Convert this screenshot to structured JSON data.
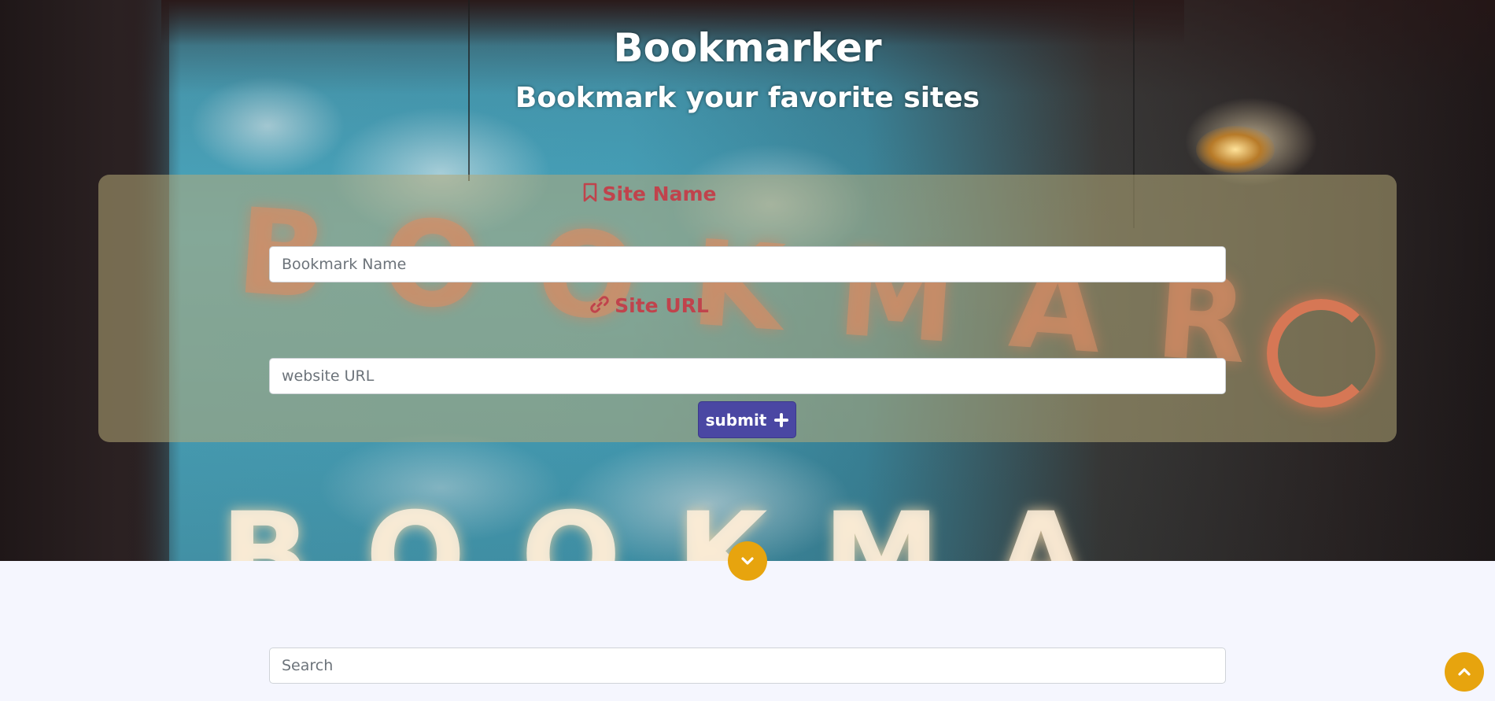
{
  "header": {
    "title": "Bookmarker",
    "subtitle": "Bookmark your favorite sites"
  },
  "form": {
    "site_name_label": "Site Name",
    "site_name_placeholder": "Bookmark Name",
    "site_url_label": "Site URL",
    "site_url_placeholder": "website URL",
    "submit_label": "submit",
    "submit_icon": "plus-icon",
    "name_icon": "bookmark-icon",
    "url_icon": "link-icon"
  },
  "search": {
    "placeholder": "Search"
  },
  "nav": {
    "scroll_down_icon": "chevron-down-icon",
    "back_to_top_icon": "chevron-up-icon"
  },
  "colors": {
    "heading_red": "#c0434c",
    "submit_purple": "#4a47a3",
    "accent_orange": "#e7a40e",
    "page_bg": "#f5f6fe"
  }
}
